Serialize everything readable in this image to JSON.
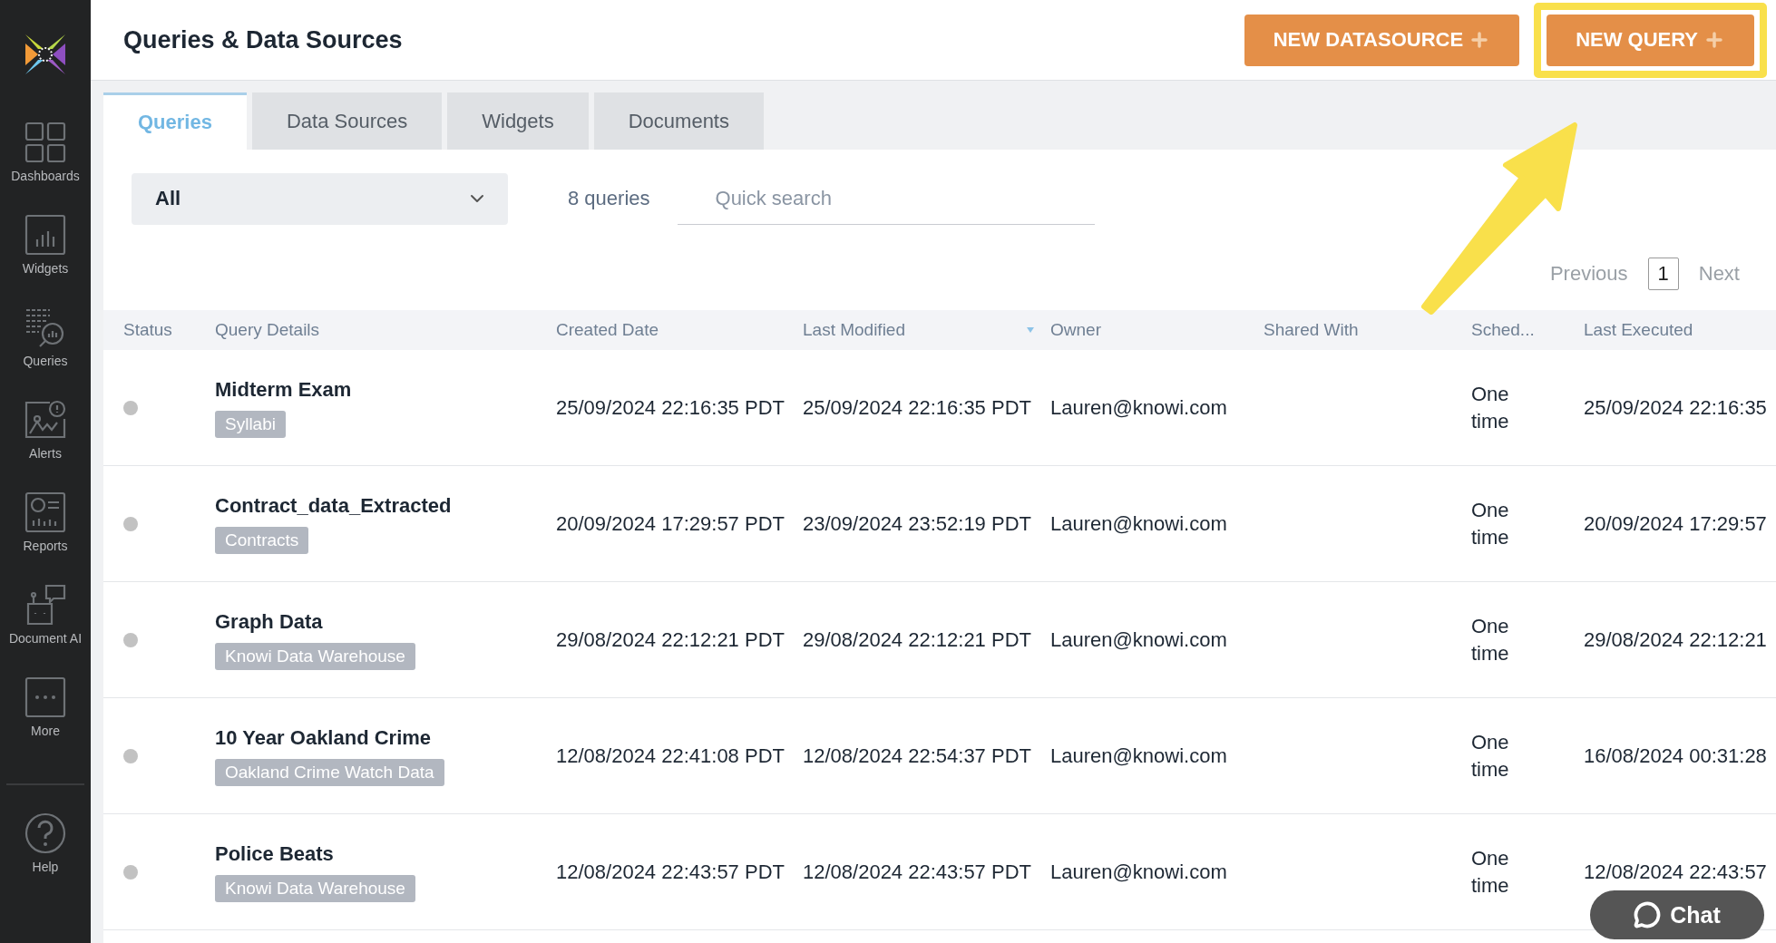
{
  "sidebar": {
    "items": [
      {
        "label": "Dashboards"
      },
      {
        "label": "Widgets"
      },
      {
        "label": "Queries"
      },
      {
        "label": "Alerts"
      },
      {
        "label": "Reports"
      },
      {
        "label": "Document AI"
      },
      {
        "label": "More"
      }
    ],
    "help": {
      "label": "Help"
    }
  },
  "header": {
    "title": "Queries & Data Sources",
    "buttons": [
      {
        "label": "NEW DATASOURCE",
        "highlighted": false
      },
      {
        "label": "NEW QUERY",
        "highlighted": true
      }
    ]
  },
  "tabs": [
    {
      "label": "Queries",
      "selected": true
    },
    {
      "label": "Data Sources",
      "selected": false
    },
    {
      "label": "Widgets",
      "selected": false
    },
    {
      "label": "Documents",
      "selected": false
    }
  ],
  "filter": {
    "value": "All"
  },
  "count": "8 queries",
  "search": {
    "placeholder": "Quick search"
  },
  "pagination": {
    "previous": "Previous",
    "page": "1",
    "next": "Next"
  },
  "table": {
    "columns": [
      {
        "label": "Status",
        "sorted": false
      },
      {
        "label": "Query Details",
        "sorted": false
      },
      {
        "label": "Created Date",
        "sorted": false
      },
      {
        "label": "Last Modified",
        "sorted": true
      },
      {
        "label": "Owner",
        "sorted": false
      },
      {
        "label": "Shared With",
        "sorted": false
      },
      {
        "label": "Sched...",
        "sorted": false
      },
      {
        "label": "Last Executed",
        "sorted": false
      }
    ],
    "rows": [
      {
        "name": "Midterm Exam",
        "tag": "Syllabi",
        "created": "25/09/2024 22:16:35 PDT",
        "modified": "25/09/2024 22:16:35 PDT",
        "owner": "Lauren@knowi.com",
        "schedule": "One time",
        "last_executed": "25/09/2024 22:16:35"
      },
      {
        "name": "Contract_data_Extracted",
        "tag": "Contracts",
        "created": "20/09/2024 17:29:57 PDT",
        "modified": "23/09/2024 23:52:19 PDT",
        "owner": "Lauren@knowi.com",
        "schedule": "One time",
        "last_executed": "20/09/2024 17:29:57"
      },
      {
        "name": "Graph Data",
        "tag": "Knowi Data Warehouse",
        "created": "29/08/2024 22:12:21 PDT",
        "modified": "29/08/2024 22:12:21 PDT",
        "owner": "Lauren@knowi.com",
        "schedule": "One time",
        "last_executed": "29/08/2024 22:12:21"
      },
      {
        "name": "10 Year Oakland Crime",
        "tag": "Oakland Crime Watch Data",
        "created": "12/08/2024 22:41:08 PDT",
        "modified": "12/08/2024 22:54:37 PDT",
        "owner": "Lauren@knowi.com",
        "schedule": "One time",
        "last_executed": "16/08/2024 00:31:28"
      },
      {
        "name": "Police Beats",
        "tag": "Knowi Data Warehouse",
        "created": "12/08/2024 22:43:57 PDT",
        "modified": "12/08/2024 22:43:57 PDT",
        "owner": "Lauren@knowi.com",
        "schedule": "One time",
        "last_executed": "12/08/2024 22:43:57"
      }
    ]
  },
  "chat": {
    "label": "Chat"
  }
}
